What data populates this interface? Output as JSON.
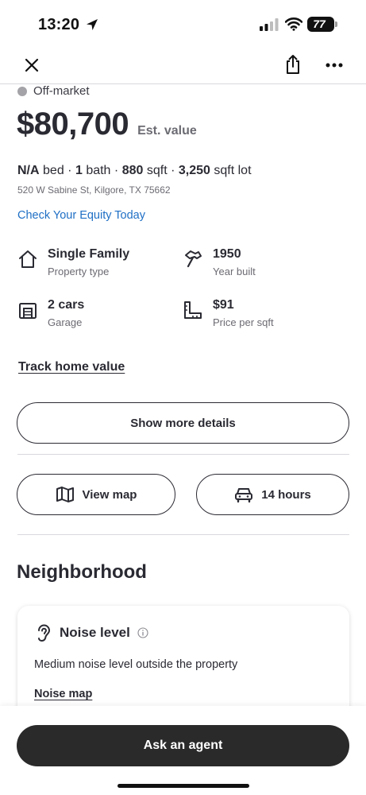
{
  "status_bar": {
    "time": "13:20",
    "battery": "77"
  },
  "navbar": {
    "close_icon": "close-icon",
    "share_icon": "share-icon",
    "more_icon": "more-dots-icon"
  },
  "listing": {
    "market_status": "Off-market",
    "price": "$80,700",
    "price_label": "Est. value",
    "beds_value": "N/A",
    "beds_unit": "bed",
    "baths_value": "1",
    "baths_unit": "bath",
    "sqft_value": "880",
    "sqft_unit": "sqft",
    "lot_value": "3,250",
    "lot_unit": "sqft lot",
    "separator": "·",
    "address": "520 W Sabine St, Kilgore, TX 75662",
    "equity_link": "Check Your Equity Today"
  },
  "attributes": [
    {
      "icon": "house-icon",
      "value": "Single Family",
      "label": "Property type"
    },
    {
      "icon": "hammer-icon",
      "value": "1950",
      "label": "Year built"
    },
    {
      "icon": "garage-icon",
      "value": "2 cars",
      "label": "Garage"
    },
    {
      "icon": "ruler-icon",
      "value": "$91",
      "label": "Price per sqft"
    }
  ],
  "actions": {
    "track_value": "Track home value",
    "show_more": "Show more details",
    "view_map": "View map",
    "commute": "14 hours"
  },
  "neighborhood": {
    "title": "Neighborhood",
    "card_title": "Noise level",
    "card_desc": "Medium noise level outside the property",
    "card_link": "Noise map"
  },
  "bottom": {
    "ask_agent": "Ask an agent"
  },
  "colors": {
    "text": "#2a2a33",
    "link": "#1f6fc5",
    "muted": "#6b6b73",
    "cta": "#2a2a2a"
  }
}
